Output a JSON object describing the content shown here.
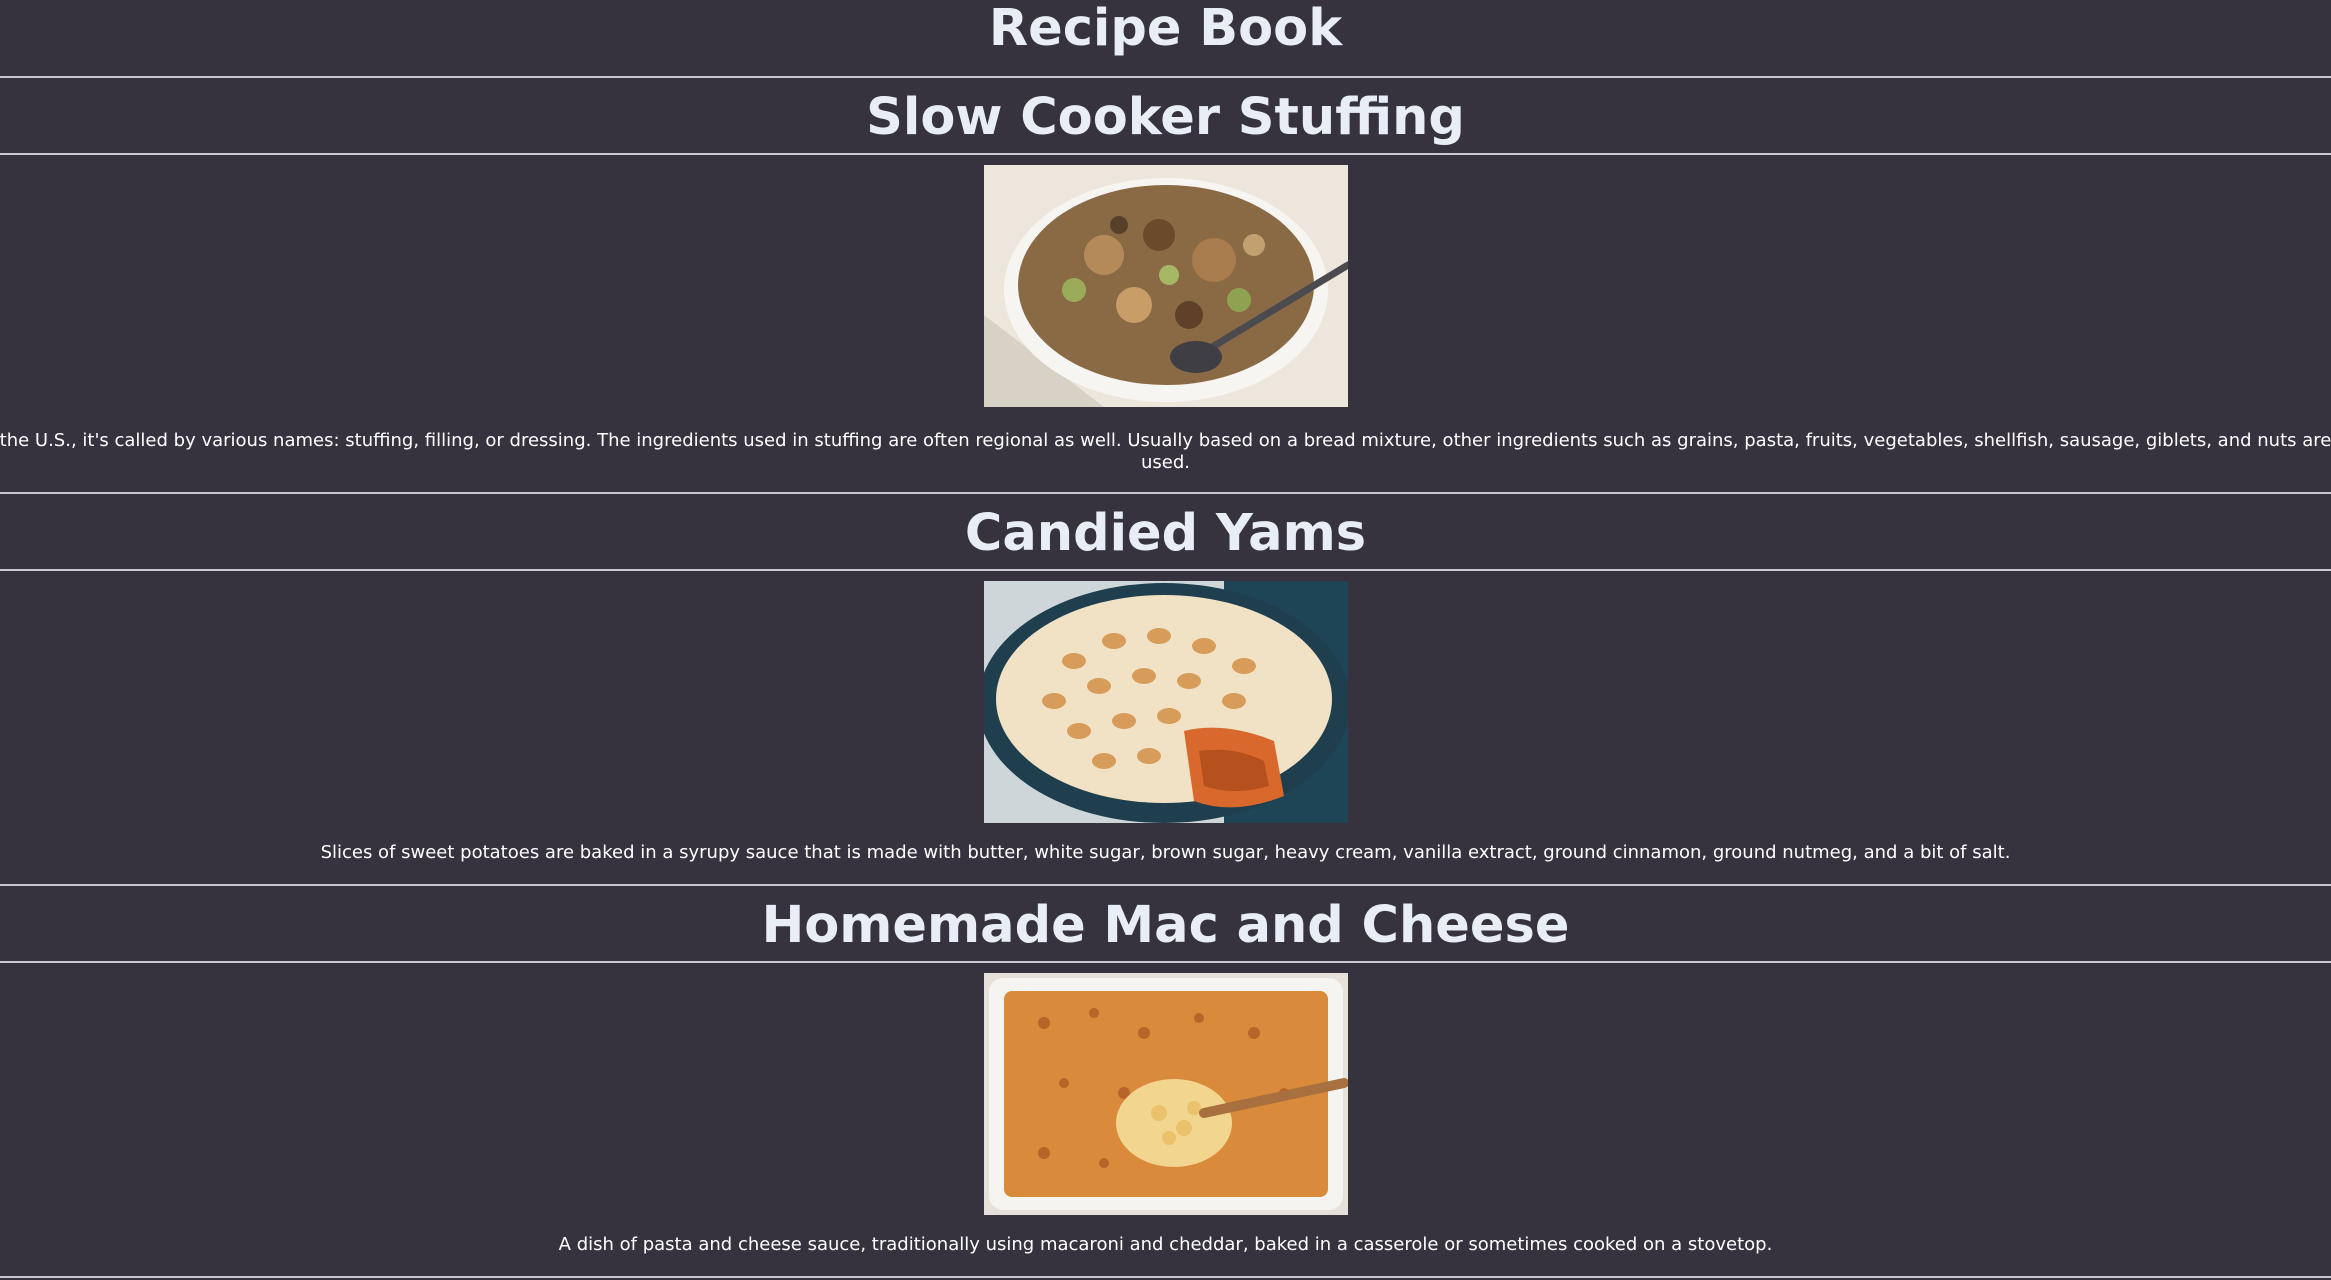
{
  "page": {
    "title": "Recipe Book"
  },
  "recipes": [
    {
      "title": "Slow Cooker Stuffing",
      "image_alt": "Bowl of bread stuffing with a spoon",
      "description": "the U.S., it's called by various names: stuffing, filling, or dressing. The ingredients used in stuffing are often regional as well. Usually based on a bread mixture, other ingredients such as grains, pasta, fruits, vegetables, shellfish, sausage, giblets, and nuts are used."
    },
    {
      "title": "Candied Yams",
      "image_alt": "Baked sweet potatoes topped with toasted marshmallows",
      "description": "Slices of sweet potatoes are baked in a syrupy sauce that is made with butter, white sugar, brown sugar, heavy cream, vanilla extract, ground cinnamon, ground nutmeg, and a bit of salt."
    },
    {
      "title": "Homemade Mac and Cheese",
      "image_alt": "Baked macaroni and cheese in a white dish with a wooden spoon",
      "description": "A dish of pasta and cheese sauce, traditionally using macaroni and cheddar, baked in a casserole or sometimes cooked on a stovetop."
    }
  ],
  "colors": {
    "background": "#36333f",
    "heading": "#e9eef6",
    "divider": "#c9c9cf"
  }
}
